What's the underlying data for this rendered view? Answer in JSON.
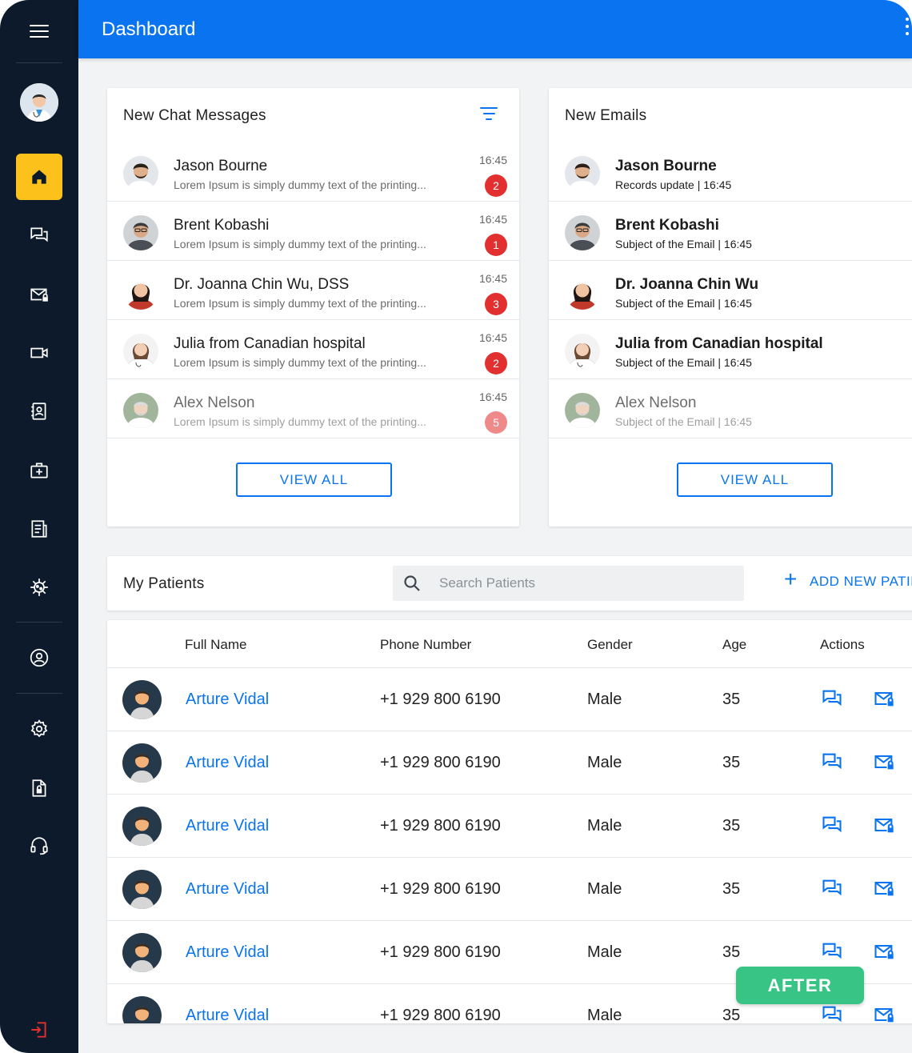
{
  "header": {
    "title": "Dashboard"
  },
  "colors": {
    "primary": "#0a74f0",
    "sidebar": "#0c1a2b",
    "active_nav": "#fcc21b",
    "badge": "#e23030",
    "after": "#38c485"
  },
  "sidebar": {
    "items": [
      {
        "icon": "home-icon",
        "active": true
      },
      {
        "icon": "chat-icon"
      },
      {
        "icon": "mail-lock-icon"
      },
      {
        "icon": "video-icon"
      },
      {
        "icon": "contact-book-icon"
      },
      {
        "icon": "medical-kit-icon"
      },
      {
        "icon": "document-icon"
      },
      {
        "icon": "virus-icon"
      },
      {
        "icon": "user-circle-icon"
      },
      {
        "icon": "gear-icon"
      },
      {
        "icon": "file-lock-icon"
      },
      {
        "icon": "headset-icon"
      },
      {
        "icon": "logout-icon"
      }
    ]
  },
  "chat": {
    "title": "New Chat Messages",
    "view_all": "VIEW ALL",
    "messages": [
      {
        "name": "Jason Bourne",
        "preview": "Lorem Ipsum is simply dummy text of the printing...",
        "time": "16:45",
        "count": "2"
      },
      {
        "name": "Brent Kobashi",
        "preview": "Lorem Ipsum is simply dummy text of the printing...",
        "time": "16:45",
        "count": "1"
      },
      {
        "name": "Dr. Joanna Chin Wu, DSS",
        "preview": "Lorem Ipsum is simply dummy text of the printing...",
        "time": "16:45",
        "count": "3"
      },
      {
        "name": "Julia from Canadian hospital",
        "preview": "Lorem Ipsum is simply dummy text of the printing...",
        "time": "16:45",
        "count": "2"
      },
      {
        "name": "Alex Nelson",
        "preview": "Lorem Ipsum is simply dummy text of the printing...",
        "time": "16:45",
        "count": "5"
      }
    ]
  },
  "emails": {
    "title": "New Emails",
    "view_all": "VIEW ALL",
    "items": [
      {
        "name": "Jason Bourne",
        "subject": "Records update | 16:45"
      },
      {
        "name": "Brent Kobashi",
        "subject": "Subject of the Email | 16:45"
      },
      {
        "name": "Dr. Joanna Chin Wu",
        "subject": "Subject of the Email | 16:45"
      },
      {
        "name": "Julia from Canadian hospital",
        "subject": "Subject of the Email | 16:45"
      },
      {
        "name": "Alex Nelson",
        "subject": "Subject of the Email | 16:45"
      }
    ]
  },
  "patients": {
    "title": "My Patients",
    "search_placeholder": "Search Patients",
    "add_label": "ADD NEW PATIENT",
    "columns": [
      "Full Name",
      "Phone Number",
      "Gender",
      "Age",
      "Actions"
    ],
    "rows": [
      {
        "name": "Arture Vidal",
        "phone": "+1 929 800 6190",
        "gender": "Male",
        "age": "35"
      },
      {
        "name": "Arture Vidal",
        "phone": "+1 929 800 6190",
        "gender": "Male",
        "age": "35"
      },
      {
        "name": "Arture Vidal",
        "phone": "+1 929 800 6190",
        "gender": "Male",
        "age": "35"
      },
      {
        "name": "Arture Vidal",
        "phone": "+1 929 800 6190",
        "gender": "Male",
        "age": "35"
      },
      {
        "name": "Arture Vidal",
        "phone": "+1 929 800 6190",
        "gender": "Male",
        "age": "35"
      },
      {
        "name": "Arture Vidal",
        "phone": "+1 929 800 6190",
        "gender": "Male",
        "age": "35"
      }
    ]
  },
  "badge": {
    "label": "AFTER"
  }
}
